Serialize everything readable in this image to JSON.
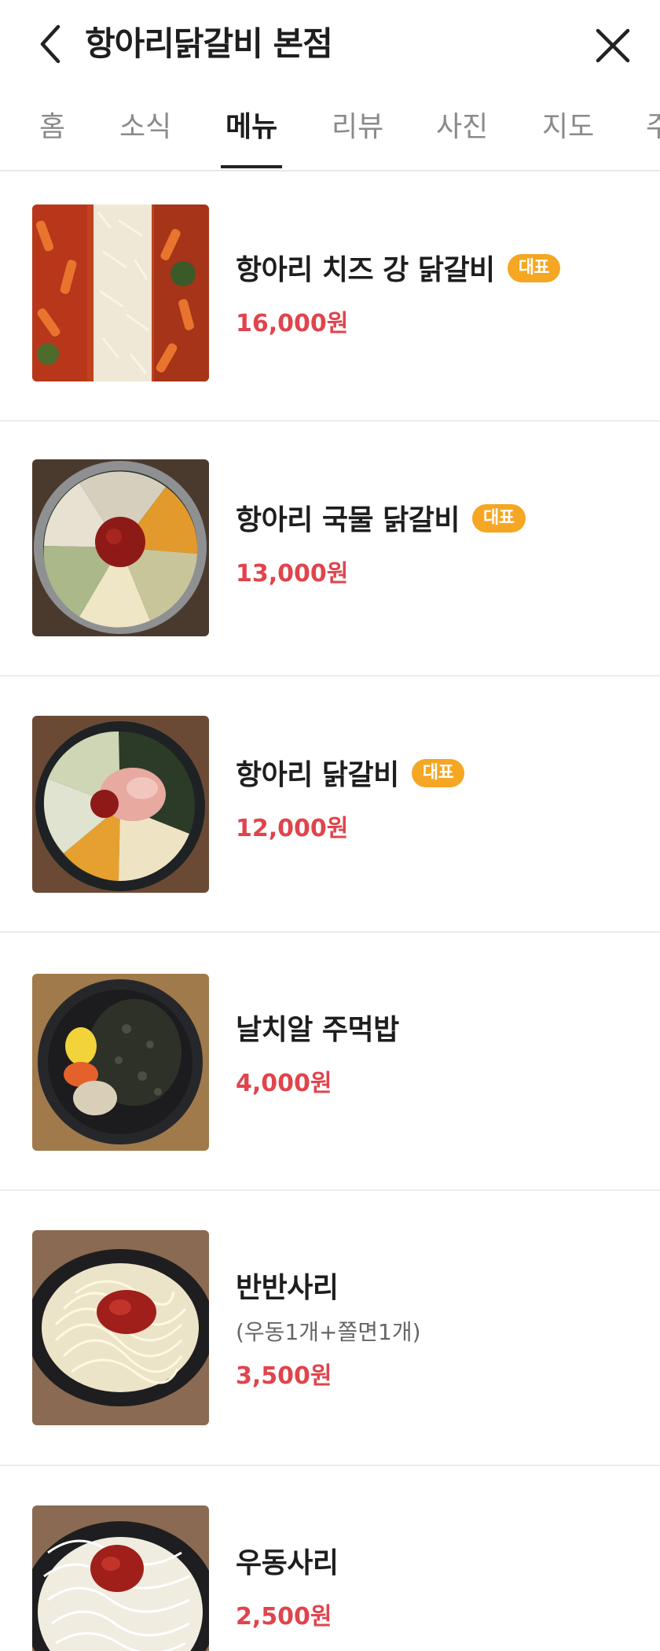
{
  "header": {
    "title": "항아리닭갈비 본점",
    "back_icon": "chevron-left-icon",
    "close_icon": "close-icon"
  },
  "tabs": [
    {
      "label": "홈",
      "active": false
    },
    {
      "label": "소식",
      "active": false
    },
    {
      "label": "메뉴",
      "active": true
    },
    {
      "label": "리뷰",
      "active": false
    },
    {
      "label": "사진",
      "active": false
    },
    {
      "label": "지도",
      "active": false
    },
    {
      "label": "주",
      "active": false
    }
  ],
  "colors": {
    "badge": "#f5a623",
    "price": "#e0444c",
    "active_tab": "#1e1e1e",
    "inactive_tab": "#8a8a8a"
  },
  "menu": {
    "items": [
      {
        "name": "항아리 치즈 강 닭갈비",
        "badge": "대표",
        "price": "16,000원"
      },
      {
        "name": "항아리 국물 닭갈비",
        "badge": "대표",
        "price": "13,000원"
      },
      {
        "name": "항아리 닭갈비",
        "badge": "대표",
        "price": "12,000원"
      },
      {
        "name": "날치알 주먹밥",
        "price": "4,000원"
      },
      {
        "name": "반반사리",
        "description": "(우동1개+쫄면1개)",
        "price": "3,500원"
      },
      {
        "name": "우동사리",
        "price": "2,500원"
      }
    ]
  }
}
